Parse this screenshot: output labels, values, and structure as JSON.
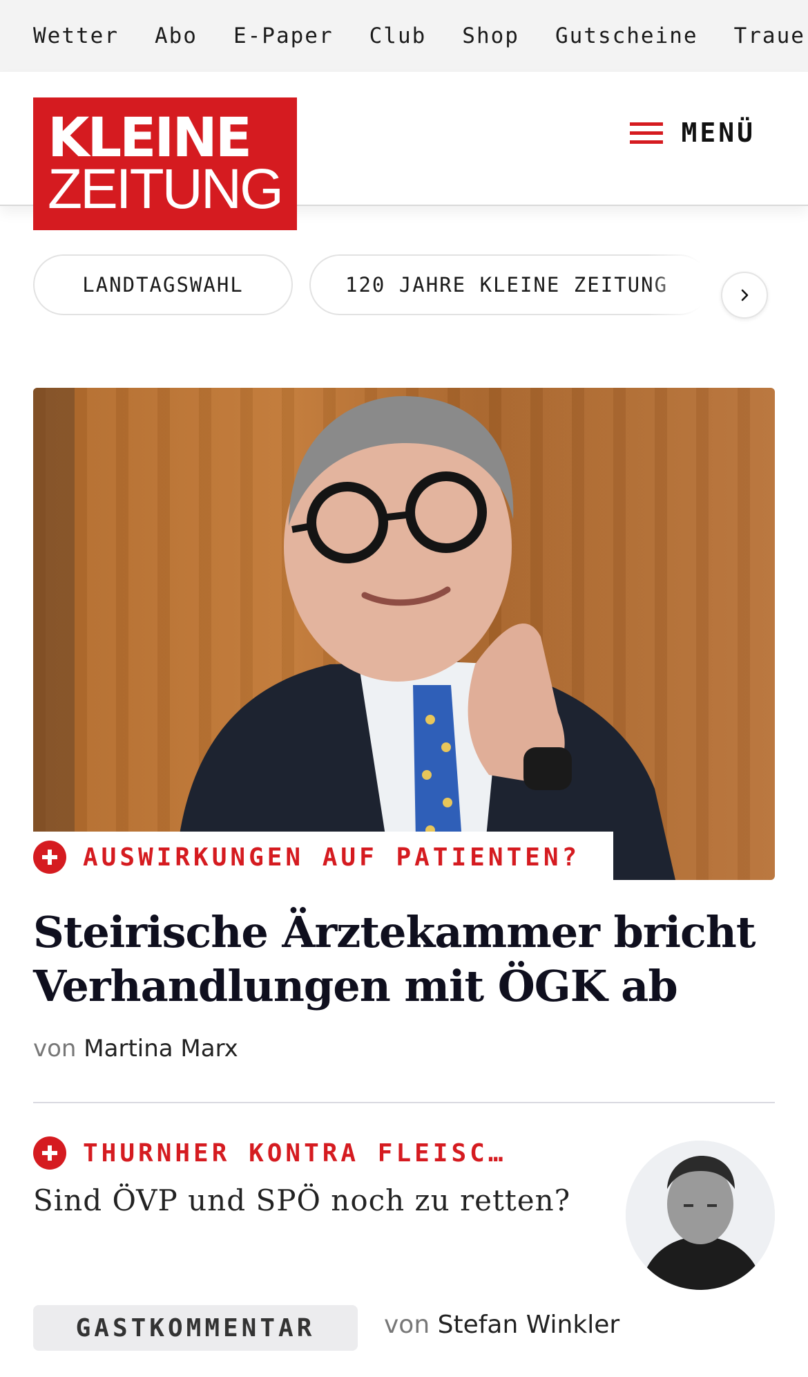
{
  "topnav": {
    "items": [
      "Wetter",
      "Abo",
      "E-Paper",
      "Club",
      "Shop",
      "Gutscheine",
      "Trauerp"
    ]
  },
  "header": {
    "logo_line1": "KLEINE",
    "logo_line2": "ZEITUNG",
    "menu_label": "MENÜ"
  },
  "topics": {
    "chips": [
      "LANDTAGSWAHL",
      "120 JAHRE KLEINE ZEITUNG"
    ]
  },
  "lead_article": {
    "kicker": "AUSWIRKUNGEN AUF PATIENTEN?",
    "headline": "Steirische Ärztekammer bricht Verhandlungen mit ÖGK ab",
    "byline_prefix": "von",
    "author": "Martina Marx"
  },
  "second_article": {
    "kicker": "THURNHER KONTRA FLEISC…",
    "title": "Sind ÖVP und SPÖ noch zu retten?",
    "badge": "GASTKOMMENTAR",
    "byline_prefix": "von",
    "author": "Stefan Winkler"
  },
  "colors": {
    "brand_red": "#d51b20",
    "headline": "#0f0f1e"
  }
}
